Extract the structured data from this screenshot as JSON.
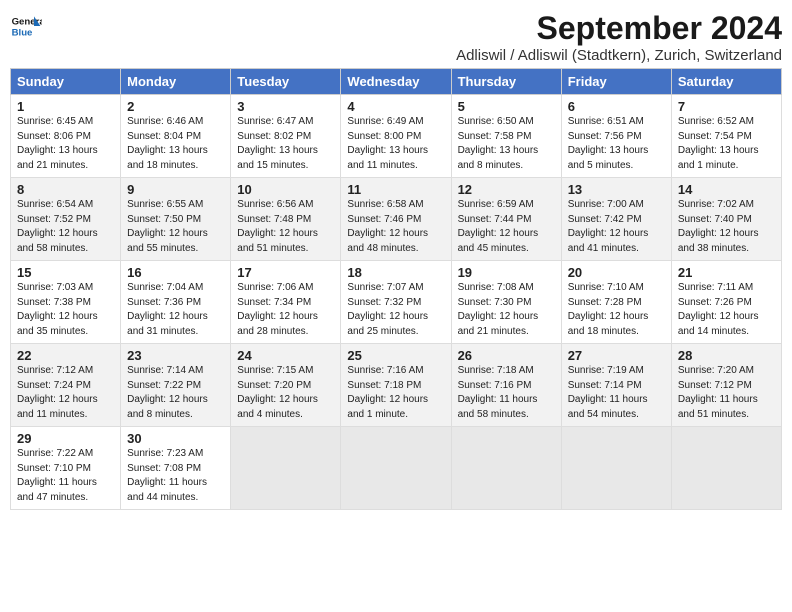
{
  "header": {
    "logo_line1": "General",
    "logo_line2": "Blue",
    "month_year": "September 2024",
    "location": "Adliswil / Adliswil (Stadtkern), Zurich, Switzerland"
  },
  "days_of_week": [
    "Sunday",
    "Monday",
    "Tuesday",
    "Wednesday",
    "Thursday",
    "Friday",
    "Saturday"
  ],
  "weeks": [
    [
      {
        "day": "1",
        "sunrise": "6:45 AM",
        "sunset": "8:06 PM",
        "daylight": "13 hours and 21 minutes."
      },
      {
        "day": "2",
        "sunrise": "6:46 AM",
        "sunset": "8:04 PM",
        "daylight": "13 hours and 18 minutes."
      },
      {
        "day": "3",
        "sunrise": "6:47 AM",
        "sunset": "8:02 PM",
        "daylight": "13 hours and 15 minutes."
      },
      {
        "day": "4",
        "sunrise": "6:49 AM",
        "sunset": "8:00 PM",
        "daylight": "13 hours and 11 minutes."
      },
      {
        "day": "5",
        "sunrise": "6:50 AM",
        "sunset": "7:58 PM",
        "daylight": "13 hours and 8 minutes."
      },
      {
        "day": "6",
        "sunrise": "6:51 AM",
        "sunset": "7:56 PM",
        "daylight": "13 hours and 5 minutes."
      },
      {
        "day": "7",
        "sunrise": "6:52 AM",
        "sunset": "7:54 PM",
        "daylight": "13 hours and 1 minute."
      }
    ],
    [
      {
        "day": "8",
        "sunrise": "6:54 AM",
        "sunset": "7:52 PM",
        "daylight": "12 hours and 58 minutes."
      },
      {
        "day": "9",
        "sunrise": "6:55 AM",
        "sunset": "7:50 PM",
        "daylight": "12 hours and 55 minutes."
      },
      {
        "day": "10",
        "sunrise": "6:56 AM",
        "sunset": "7:48 PM",
        "daylight": "12 hours and 51 minutes."
      },
      {
        "day": "11",
        "sunrise": "6:58 AM",
        "sunset": "7:46 PM",
        "daylight": "12 hours and 48 minutes."
      },
      {
        "day": "12",
        "sunrise": "6:59 AM",
        "sunset": "7:44 PM",
        "daylight": "12 hours and 45 minutes."
      },
      {
        "day": "13",
        "sunrise": "7:00 AM",
        "sunset": "7:42 PM",
        "daylight": "12 hours and 41 minutes."
      },
      {
        "day": "14",
        "sunrise": "7:02 AM",
        "sunset": "7:40 PM",
        "daylight": "12 hours and 38 minutes."
      }
    ],
    [
      {
        "day": "15",
        "sunrise": "7:03 AM",
        "sunset": "7:38 PM",
        "daylight": "12 hours and 35 minutes."
      },
      {
        "day": "16",
        "sunrise": "7:04 AM",
        "sunset": "7:36 PM",
        "daylight": "12 hours and 31 minutes."
      },
      {
        "day": "17",
        "sunrise": "7:06 AM",
        "sunset": "7:34 PM",
        "daylight": "12 hours and 28 minutes."
      },
      {
        "day": "18",
        "sunrise": "7:07 AM",
        "sunset": "7:32 PM",
        "daylight": "12 hours and 25 minutes."
      },
      {
        "day": "19",
        "sunrise": "7:08 AM",
        "sunset": "7:30 PM",
        "daylight": "12 hours and 21 minutes."
      },
      {
        "day": "20",
        "sunrise": "7:10 AM",
        "sunset": "7:28 PM",
        "daylight": "12 hours and 18 minutes."
      },
      {
        "day": "21",
        "sunrise": "7:11 AM",
        "sunset": "7:26 PM",
        "daylight": "12 hours and 14 minutes."
      }
    ],
    [
      {
        "day": "22",
        "sunrise": "7:12 AM",
        "sunset": "7:24 PM",
        "daylight": "12 hours and 11 minutes."
      },
      {
        "day": "23",
        "sunrise": "7:14 AM",
        "sunset": "7:22 PM",
        "daylight": "12 hours and 8 minutes."
      },
      {
        "day": "24",
        "sunrise": "7:15 AM",
        "sunset": "7:20 PM",
        "daylight": "12 hours and 4 minutes."
      },
      {
        "day": "25",
        "sunrise": "7:16 AM",
        "sunset": "7:18 PM",
        "daylight": "12 hours and 1 minute."
      },
      {
        "day": "26",
        "sunrise": "7:18 AM",
        "sunset": "7:16 PM",
        "daylight": "11 hours and 58 minutes."
      },
      {
        "day": "27",
        "sunrise": "7:19 AM",
        "sunset": "7:14 PM",
        "daylight": "11 hours and 54 minutes."
      },
      {
        "day": "28",
        "sunrise": "7:20 AM",
        "sunset": "7:12 PM",
        "daylight": "11 hours and 51 minutes."
      }
    ],
    [
      {
        "day": "29",
        "sunrise": "7:22 AM",
        "sunset": "7:10 PM",
        "daylight": "11 hours and 47 minutes."
      },
      {
        "day": "30",
        "sunrise": "7:23 AM",
        "sunset": "7:08 PM",
        "daylight": "11 hours and 44 minutes."
      },
      null,
      null,
      null,
      null,
      null
    ]
  ]
}
